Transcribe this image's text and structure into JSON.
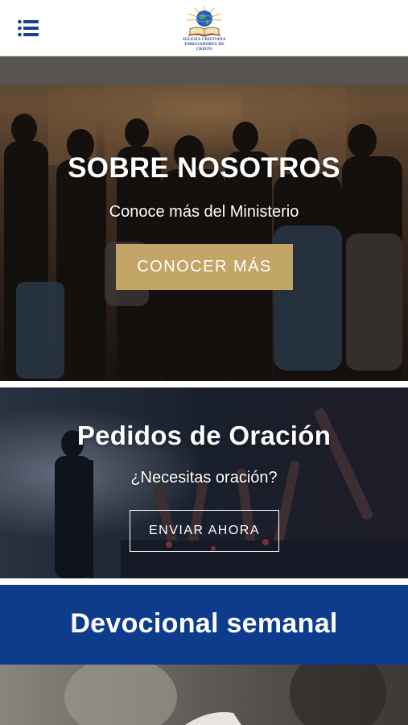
{
  "header": {
    "menu_icon": "hamburger-menu-icon",
    "logo": {
      "line1": "IGLESIA CRISTIANA",
      "line2": "EMBAJADORES DE CRISTO",
      "icon": "globe-bible-logo"
    }
  },
  "hero": {
    "title": "SOBRE NOSOTROS",
    "subtitle": "Conoce más del Ministerio",
    "button_label": "CONOCER MÁS",
    "button_color": "#c2a667"
  },
  "prayer": {
    "title": "Pedidos de Oración",
    "subtitle": "¿Necesitas oración?",
    "button_label": "ENVIAR AHORA"
  },
  "devotional": {
    "title": "Devocional semanal",
    "background": "#0d3c8c"
  },
  "colors": {
    "menu_icon": "#1d3f8f",
    "gold": "#c2a667",
    "navy": "#0d3c8c"
  }
}
